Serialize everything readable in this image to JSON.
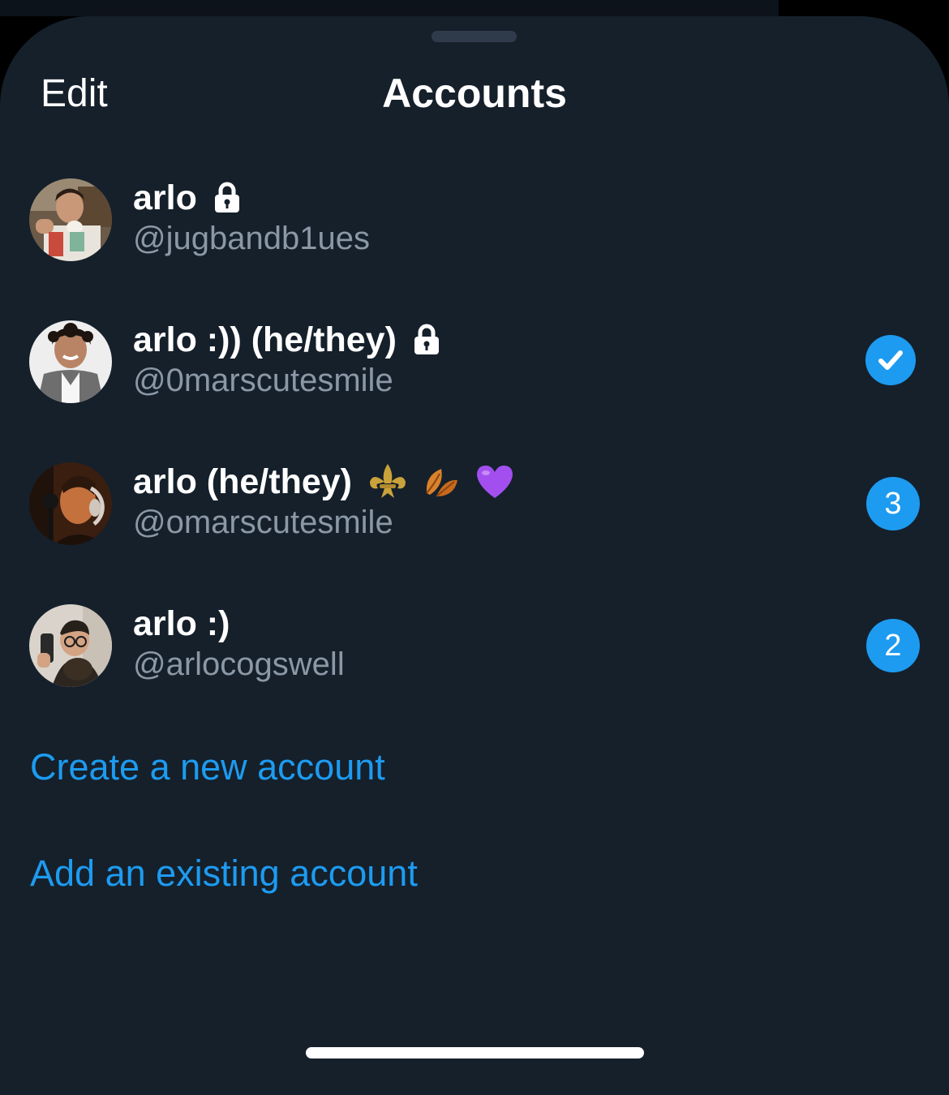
{
  "header": {
    "edit_label": "Edit",
    "title": "Accounts"
  },
  "accounts": [
    {
      "display_name": "arlo",
      "handle": "@jugbandb1ues",
      "protected": true,
      "emoji": [],
      "selected": false,
      "badge": ""
    },
    {
      "display_name": "arlo :)) (he/they)",
      "handle": "@0marscutesmile",
      "protected": true,
      "emoji": [],
      "selected": true,
      "badge": ""
    },
    {
      "display_name": "arlo (he/they)",
      "handle": "@omarscutesmile",
      "protected": false,
      "emoji": [
        "fleur-de-lis-icon",
        "fallen-leaf-icon",
        "purple-heart-icon"
      ],
      "selected": false,
      "badge": "3"
    },
    {
      "display_name": "arlo :)",
      "handle": "@arlocogswell",
      "protected": false,
      "emoji": [],
      "selected": false,
      "badge": "2"
    }
  ],
  "actions": {
    "create_label": "Create a new account",
    "add_label": "Add an existing account"
  },
  "colors": {
    "sheet_background": "#15202b",
    "accent": "#1d9bf0",
    "secondary_text": "#8b98a5",
    "primary_text": "#ffffff"
  }
}
